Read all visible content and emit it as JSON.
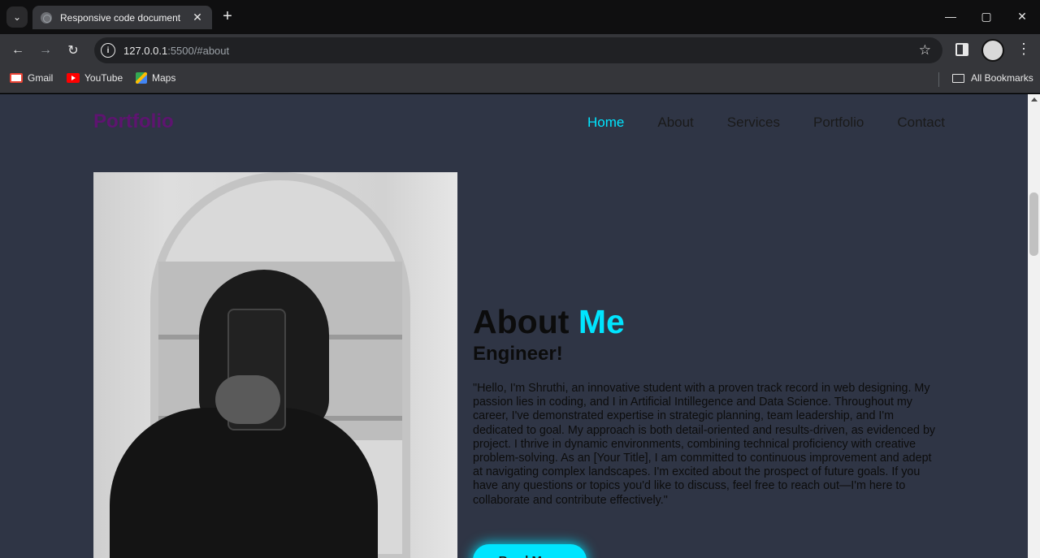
{
  "browser": {
    "tab_title": "Responsive code document",
    "url_host": "127.0.0.1",
    "url_path": ":5500/#about",
    "bookmarks": [
      {
        "label": "Gmail",
        "icon": "gmail-icon"
      },
      {
        "label": "YouTube",
        "icon": "youtube-icon"
      },
      {
        "label": "Maps",
        "icon": "maps-icon"
      }
    ],
    "all_bookmarks_label": "All Bookmarks"
  },
  "site": {
    "logo": "Portfolio",
    "nav": [
      {
        "label": "Home",
        "active": true
      },
      {
        "label": "About",
        "active": false
      },
      {
        "label": "Services",
        "active": false
      },
      {
        "label": "Portfolio",
        "active": false
      },
      {
        "label": "Contact",
        "active": false
      }
    ],
    "colors": {
      "accent": "#00e5ff",
      "logo": "#5e1470",
      "background": "#2f3545"
    }
  },
  "about": {
    "title_main": "About",
    "title_accent": "Me",
    "subtitle": "Engineer!",
    "text": "\"Hello, I'm Shruthi, an innovative student with a proven track record in web designing. My passion lies in coding, and I in Artificial Intillegence and Data Science. Throughout my career, I've demonstrated expertise in strategic planning, team leadership, and I'm dedicated to goal. My approach is both detail-oriented and results-driven, as evidenced by project. I thrive in dynamic environments, combining technical proficiency with creative problem-solving. As an [Your Title], I am committed to continuous improvement and adept at navigating complex landscapes. I'm excited about the prospect of future goals. If you have any questions or topics you'd like to discuss, feel free to reach out—I'm here to collaborate and contribute effectively.\"",
    "button_label": "Read More"
  }
}
